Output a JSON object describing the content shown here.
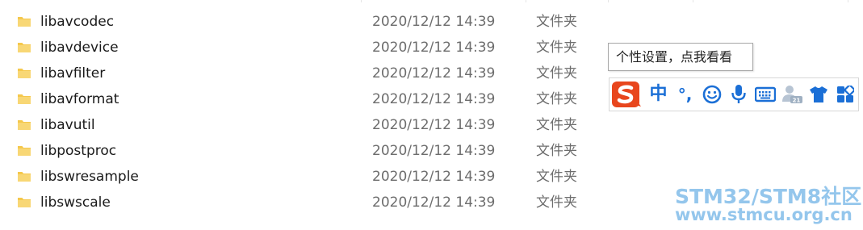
{
  "files": [
    {
      "name": "libavcodec",
      "modified": "2020/12/12 14:39",
      "type": "文件夹"
    },
    {
      "name": "libavdevice",
      "modified": "2020/12/12 14:39",
      "type": "文件夹"
    },
    {
      "name": "libavfilter",
      "modified": "2020/12/12 14:39",
      "type": "文件夹"
    },
    {
      "name": "libavformat",
      "modified": "2020/12/12 14:39",
      "type": "文件夹"
    },
    {
      "name": "libavutil",
      "modified": "2020/12/12 14:39",
      "type": "文件夹"
    },
    {
      "name": "libpostproc",
      "modified": "2020/12/12 14:39",
      "type": "文件夹"
    },
    {
      "name": "libswresample",
      "modified": "2020/12/12 14:39",
      "type": "文件夹"
    },
    {
      "name": "libswscale",
      "modified": "2020/12/12 14:39",
      "type": "文件夹"
    }
  ],
  "ime": {
    "tooltip": "个性设置，点我看看",
    "mode_label": "中",
    "punct_label": "°,",
    "buttons": [
      "sogou-logo-icon",
      "chinese-mode-icon",
      "punctuation-icon",
      "emoji-icon",
      "microphone-icon",
      "keyboard-icon",
      "user-account-icon",
      "skin-shirt-icon",
      "toolbox-grid-icon"
    ],
    "accent_color": "#1b6fd6",
    "logo_color": "#e8461d"
  },
  "watermark": {
    "line1": "STM32/STM8社区",
    "line2": "www.stmcu.org.cn"
  },
  "folder_icon_color": "#f5c84c"
}
